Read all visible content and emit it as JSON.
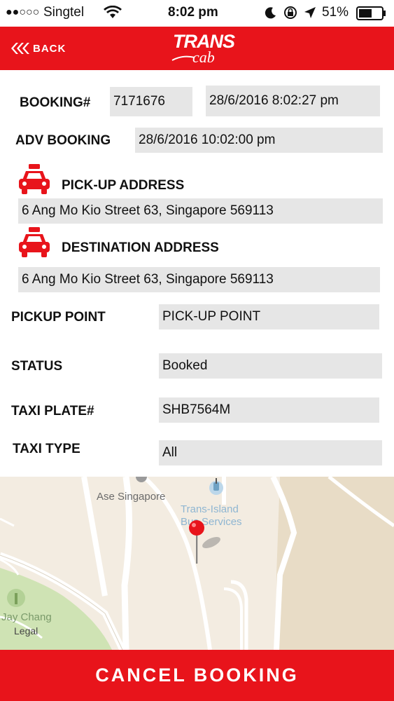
{
  "status_bar": {
    "signal": "●●○○○",
    "carrier": "Singtel",
    "time": "8:02 pm",
    "battery": "51%"
  },
  "header": {
    "back_label": "BACK",
    "logo_top": "TRANS",
    "logo_bottom": "cab"
  },
  "booking": {
    "number_label": "BOOKING#",
    "number_value": "7171676",
    "created_value": "28/6/2016 8:02:27 pm",
    "adv_label": "ADV BOOKING",
    "adv_value": "28/6/2016 10:02:00 pm"
  },
  "pickup": {
    "label": "PICK-UP ADDRESS",
    "value": "6 Ang Mo Kio Street 63, Singapore 569113"
  },
  "destination": {
    "label": "DESTINATION ADDRESS",
    "value": "6 Ang Mo Kio Street 63, Singapore 569113"
  },
  "details": {
    "pickup_point_label": "PICKUP POINT",
    "pickup_point_value": "PICK-UP POINT",
    "status_label": "STATUS",
    "status_value": "Booked",
    "plate_label": "TAXI PLATE#",
    "plate_value": "SHB7564M",
    "type_label": "TAXI TYPE",
    "type_value": "All"
  },
  "map": {
    "place_1": "Ase Singapore",
    "place_2_line1": "Trans-Island",
    "place_2_line2": "Bus Services",
    "place_3": "Jay Chang",
    "legal": "Legal"
  },
  "cancel_label": "CANCEL BOOKING",
  "colors": {
    "brand_red": "#e8141b",
    "field_gray": "#e6e6e6"
  }
}
